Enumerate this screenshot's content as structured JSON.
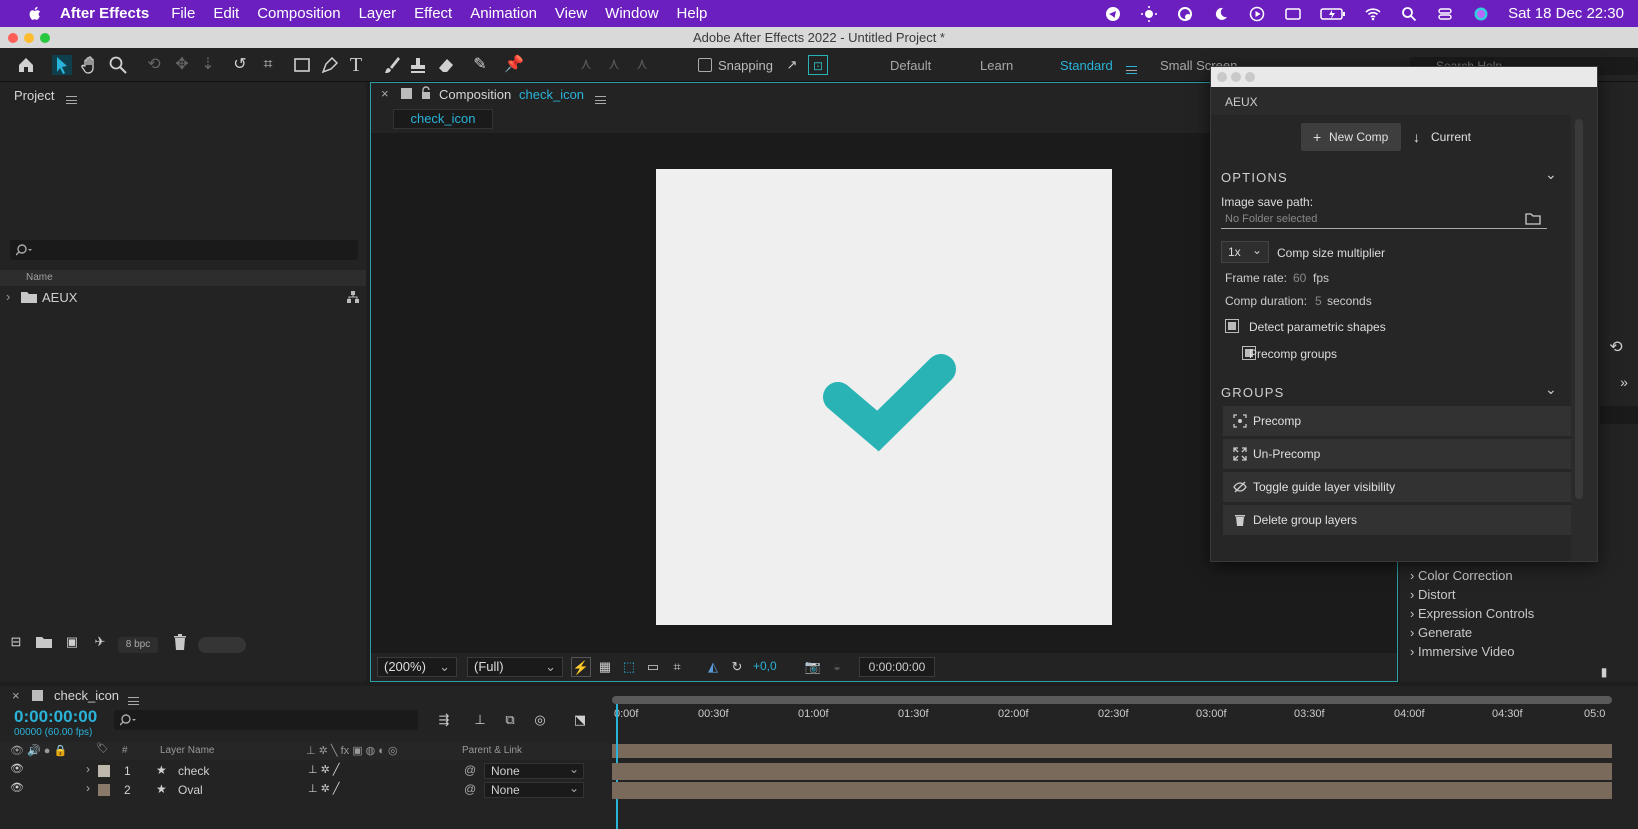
{
  "menubar": {
    "app": "After Effects",
    "items": [
      "File",
      "Edit",
      "Composition",
      "Layer",
      "Effect",
      "Animation",
      "View",
      "Window",
      "Help"
    ],
    "datetime": "Sat 18 Dec  22:30"
  },
  "window": {
    "title": "Adobe After Effects 2022 - Untitled Project *"
  },
  "toolbar": {
    "snapping": "Snapping",
    "workspaces": [
      "Default",
      "Learn",
      "Standard",
      "Small Screen"
    ],
    "active_workspace": "Standard",
    "search_placeholder": "Search Help"
  },
  "project": {
    "title": "Project",
    "column_name": "Name",
    "items": [
      {
        "name": "AEUX"
      }
    ],
    "bpc": "8 bpc"
  },
  "composition": {
    "tab_label": "Composition",
    "comp_name": "check_icon",
    "breadcrumb": "check_icon",
    "zoom": "(200%)",
    "resolution": "(Full)",
    "exposure": "+0,0",
    "timecode": "0:00:00:00",
    "check_color": "#2ab3b4",
    "canvas_color": "#efefef"
  },
  "effects": {
    "items": [
      "Color Correction",
      "Distort",
      "Expression Controls",
      "Generate",
      "Immersive Video"
    ]
  },
  "aeux": {
    "title": "AEUX",
    "new_comp": "New Comp",
    "current": "Current",
    "options_title": "OPTIONS",
    "image_save_path_label": "Image save path:",
    "image_save_path_value": "No Folder selected",
    "multiplier": "1x",
    "multiplier_label": "Comp size multiplier",
    "frame_rate_label": "Frame rate:",
    "frame_rate_value": "60",
    "frame_rate_unit": "fps",
    "duration_label": "Comp duration:",
    "duration_value": "5",
    "duration_unit": "seconds",
    "detect_shapes": "Detect parametric shapes",
    "precomp_groups": "Precomp groups",
    "groups_title": "GROUPS",
    "buttons": [
      "Precomp",
      "Un-Precomp",
      "Toggle guide layer visibility",
      "Delete group layers"
    ]
  },
  "timeline": {
    "comp_name": "check_icon",
    "timecode": "0:00:00:00",
    "frames": "00000 (60.00 fps)",
    "col_layer_name": "Layer Name",
    "col_parent": "Parent & Link",
    "ruler": [
      "0:00f",
      "00:30f",
      "01:00f",
      "01:30f",
      "02:00f",
      "02:30f",
      "03:00f",
      "03:30f",
      "04:00f",
      "04:30f",
      "05:0"
    ],
    "layers": [
      {
        "num": "1",
        "name": "check",
        "parent": "None"
      },
      {
        "num": "2",
        "name": "Oval",
        "parent": "None"
      }
    ]
  }
}
